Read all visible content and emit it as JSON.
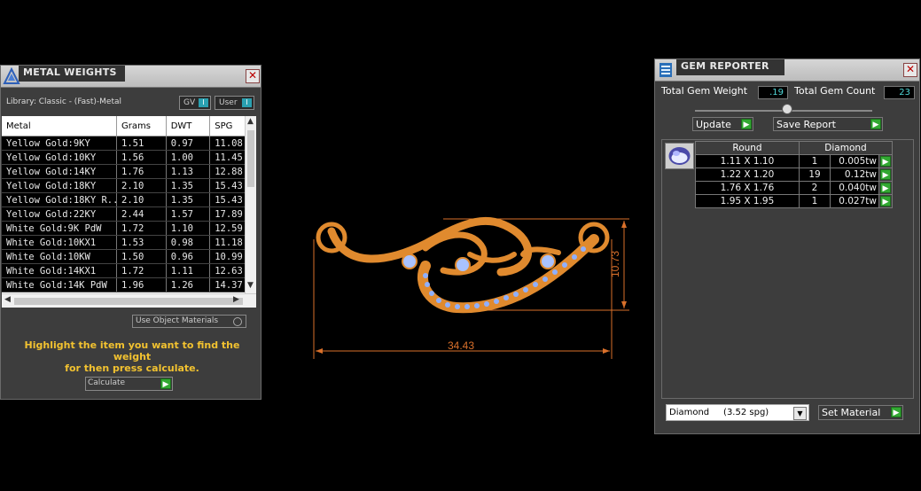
{
  "metal_weights": {
    "title": "METAL WEIGHTS",
    "library_label": "Library: Classic - (Fast)-Metal",
    "toggle_gv": "GV",
    "toggle_user": "User",
    "toggle_glyph": "I",
    "columns": [
      "Metal",
      "Grams",
      "DWT",
      "SPG"
    ],
    "rows": [
      {
        "metal": "Yellow Gold:9KY",
        "grams": "1.51",
        "dwt": "0.97",
        "spg": "11.08"
      },
      {
        "metal": "Yellow Gold:10KY",
        "grams": "1.56",
        "dwt": "1.00",
        "spg": "11.45"
      },
      {
        "metal": "Yellow Gold:14KY",
        "grams": "1.76",
        "dwt": "1.13",
        "spg": "12.88"
      },
      {
        "metal": "Yellow Gold:18KY",
        "grams": "2.10",
        "dwt": "1.35",
        "spg": "15.43"
      },
      {
        "metal": "Yellow Gold:18KY R...",
        "grams": "2.10",
        "dwt": "1.35",
        "spg": "15.43"
      },
      {
        "metal": "Yellow Gold:22KY",
        "grams": "2.44",
        "dwt": "1.57",
        "spg": "17.89"
      },
      {
        "metal": "White Gold:9K PdW",
        "grams": "1.72",
        "dwt": "1.10",
        "spg": "12.59"
      },
      {
        "metal": "White Gold:10KX1",
        "grams": "1.53",
        "dwt": "0.98",
        "spg": "11.18"
      },
      {
        "metal": "White Gold:10KW",
        "grams": "1.50",
        "dwt": "0.96",
        "spg": "10.99"
      },
      {
        "metal": "White Gold:14KX1",
        "grams": "1.72",
        "dwt": "1.11",
        "spg": "12.63"
      },
      {
        "metal": "White Gold:14K PdW",
        "grams": "1.96",
        "dwt": "1.26",
        "spg": "14.37"
      }
    ],
    "use_object_materials": "Use Object Materials",
    "hint_line1": "Highlight the item you want to find the weight",
    "hint_line2": "for then press calculate.",
    "calculate_label": "Calculate",
    "close_glyph": "✕"
  },
  "gem_reporter": {
    "title": "GEM REPORTER",
    "total_weight_label": "Total Gem Weight",
    "total_weight_value": ".19",
    "total_count_label": "Total Gem Count",
    "total_count_value": "23",
    "update_label": "Update",
    "save_report_label": "Save Report",
    "table_headers": [
      "Round",
      "Diamond"
    ],
    "gems": [
      {
        "size": "1.11 X 1.10",
        "count": "1",
        "weight": "0.005tw"
      },
      {
        "size": "1.22 X 1.20",
        "count": "19",
        "weight": "0.12tw"
      },
      {
        "size": "1.76 X 1.76",
        "count": "2",
        "weight": "0.040tw"
      },
      {
        "size": "1.95 X 1.95",
        "count": "1",
        "weight": "0.027tw"
      }
    ],
    "material_value": "Diamond     (3.52 spg)",
    "set_material_label": "Set Material",
    "close_glyph": "✕",
    "arrow_glyph": "▶"
  },
  "viewport": {
    "dim_width": "34.43",
    "dim_height": "10.73",
    "metal_color": "#e08a2e",
    "dimension_color": "#d9702a",
    "gem_color": "#8fb0ff"
  }
}
